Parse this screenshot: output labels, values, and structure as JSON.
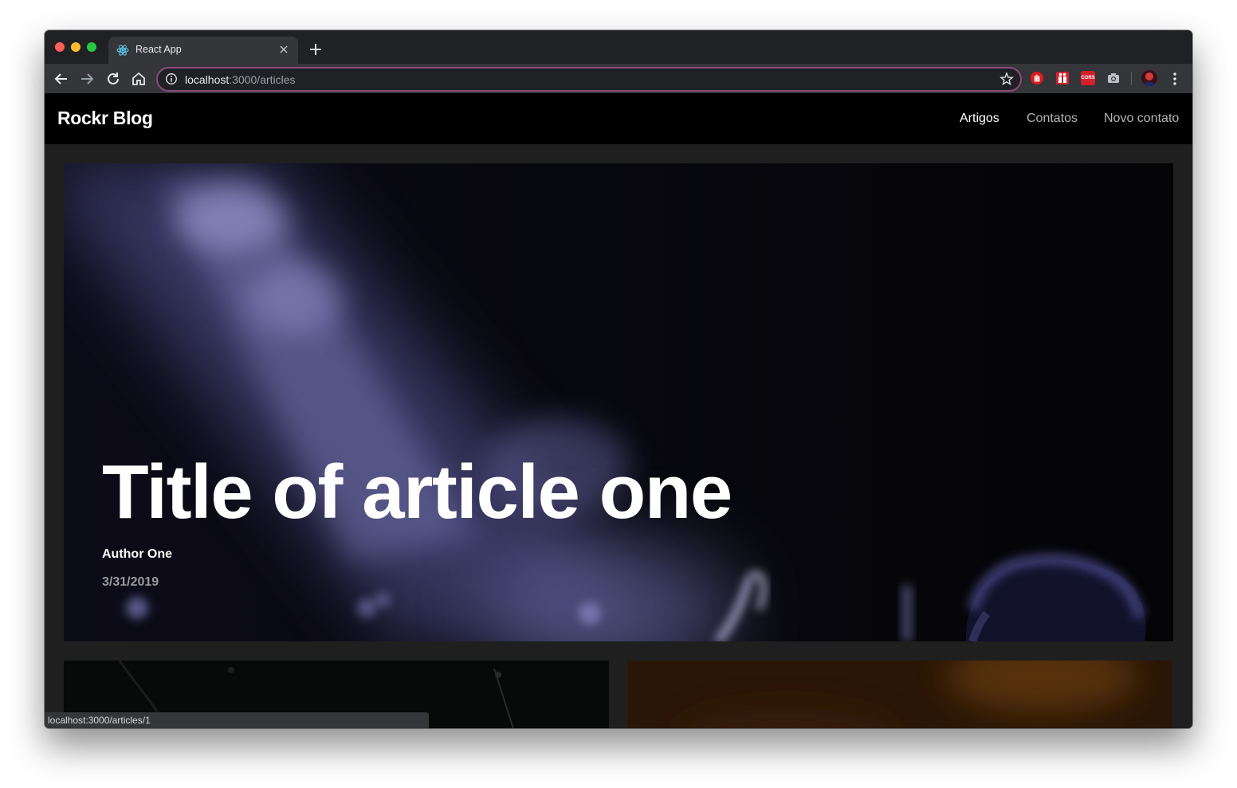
{
  "browser": {
    "tab": {
      "title": "React App",
      "favicon": "react-logo-icon",
      "close_icon": "close-icon"
    },
    "new_tab_icon": "plus-icon",
    "toolbar": {
      "back_icon": "arrow-left-icon",
      "forward_icon": "arrow-right-icon",
      "reload_icon": "reload-icon",
      "home_icon": "home-icon",
      "address": {
        "host": "localhost",
        "path": ":3000/articles",
        "info_icon": "info-icon",
        "bookmark_icon": "star-icon"
      },
      "extensions": [
        "hand-stop-icon",
        "gift-extension-icon",
        "cors-extension-icon",
        "camera-icon"
      ],
      "cors_label": "CORS",
      "menu_icon": "kebab-menu-icon"
    },
    "status_bar": "localhost:3000/articles/1",
    "colors": {
      "frame": "#202124",
      "toolbar": "#35363a",
      "omnibox_border": "#8a4b7e"
    }
  },
  "page": {
    "brand": "Rockr Blog",
    "nav": [
      {
        "label": "Artigos",
        "active": true
      },
      {
        "label": "Contatos",
        "active": false
      },
      {
        "label": "Novo contato",
        "active": false
      }
    ],
    "featured": {
      "title": "Title of article one",
      "author": "Author One",
      "date": "3/31/2019"
    },
    "colors": {
      "navbar_bg": "#000000",
      "page_bg": "#1f1f1f",
      "accent": "#ffffff",
      "muted": "#9a9a9f"
    }
  }
}
